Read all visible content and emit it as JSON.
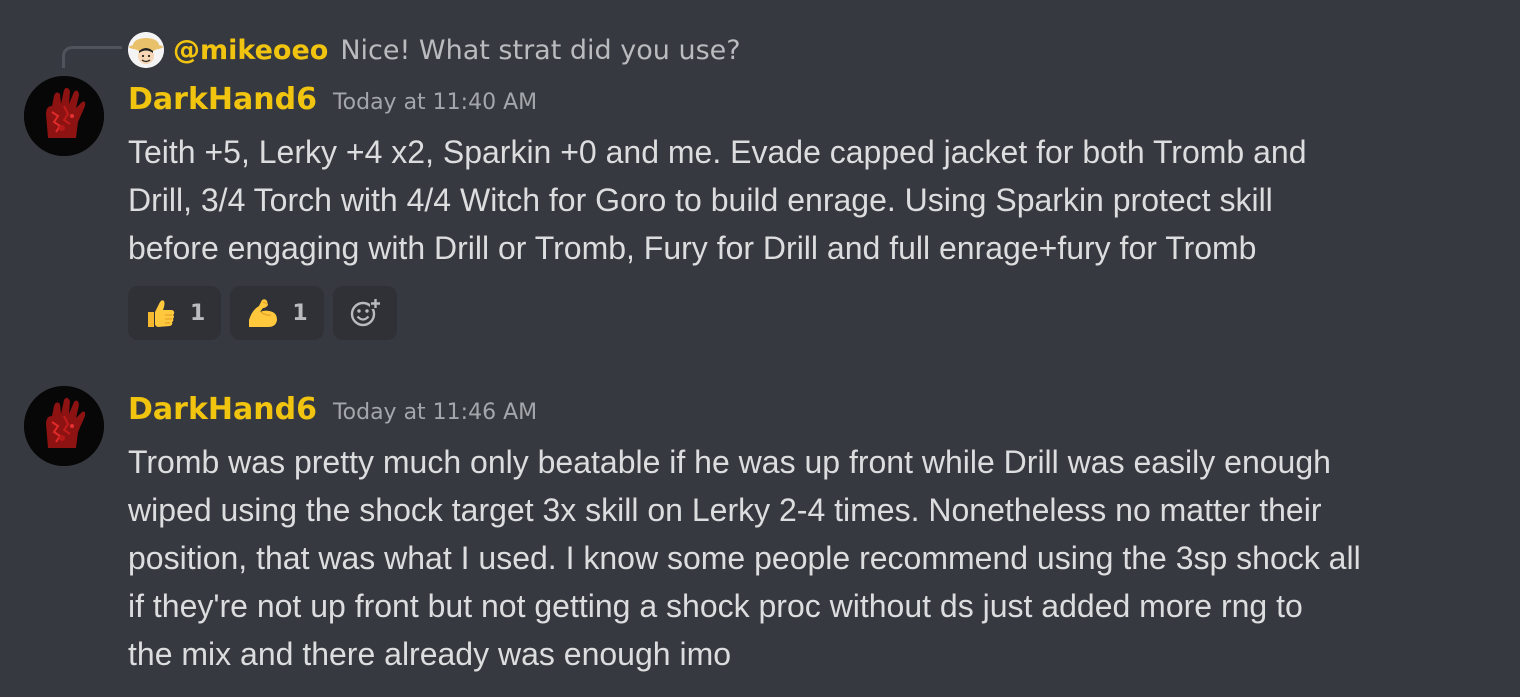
{
  "reply": {
    "author": "@mikeoeo",
    "text": "Nice! What strat did you use?",
    "author_color": "#f1c40f"
  },
  "messages": [
    {
      "author": "DarkHand6",
      "timestamp": "Today at 11:40 AM",
      "lines": [
        "Teith +5, Lerky +4 x2, Sparkin +0 and me. Evade capped jacket for both Tromb and",
        "Drill, 3/4 Torch with 4/4 Witch for Goro to build enrage. Using Sparkin protect skill",
        "before engaging with Drill or Tromb, Fury for Drill and full enrage+fury for Tromb"
      ],
      "reactions": [
        {
          "emoji": "thumbs-up",
          "count": "1"
        },
        {
          "emoji": "flexed-biceps",
          "count": "1"
        }
      ]
    },
    {
      "author": "DarkHand6",
      "timestamp": "Today at 11:46 AM",
      "lines": [
        "Tromb was pretty much only beatable if he was up front while Drill was easily enough",
        "wiped using the shock target 3x skill on Lerky 2-4 times. Nonetheless no matter their",
        "position, that was what I used. I know some people recommend using the 3sp shock all",
        "if they're not up front but not getting a shock proc without ds just added more rng to",
        "the mix and there already was enough imo"
      ]
    }
  ],
  "colors": {
    "background": "#36393f",
    "username": "#f1c40f",
    "text": "#dcddde",
    "muted": "#a3a6aa",
    "reaction_bg": "#2f3136"
  },
  "icons": {
    "reply_avatar": "straw-hat-character-icon",
    "user_avatar": "red-hand-icon",
    "add_reaction": "add-reaction-icon"
  }
}
